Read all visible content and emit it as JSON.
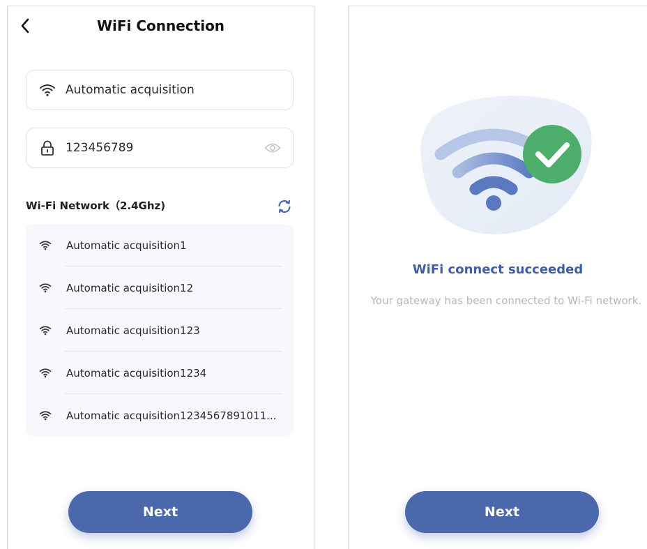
{
  "left_screen": {
    "header": {
      "title": "WiFi Connection",
      "back_icon": "chevron-left-icon"
    },
    "ssid_field": {
      "value": "Automatic acquisition",
      "icon": "wifi-icon"
    },
    "password_field": {
      "value": "123456789",
      "icon": "lock-icon",
      "toggle_icon": "eye-icon"
    },
    "network_section": {
      "title": "Wi-Fi Network（2.4Ghz)",
      "refresh_icon": "refresh-icon"
    },
    "networks": [
      {
        "name": "Automatic acquisition1"
      },
      {
        "name": "Automatic acquisition12"
      },
      {
        "name": "Automatic acquisition123"
      },
      {
        "name": "Automatic acquisition1234"
      },
      {
        "name": "Automatic acquisition1234567891011..."
      }
    ],
    "next_button": {
      "label": "Next"
    }
  },
  "right_screen": {
    "illustration_icon": "wifi-success-icon",
    "title": "WiFi connect succeeded",
    "description": "Your gateway has been connected to Wi-Fi network.",
    "next_button": {
      "label": "Next"
    }
  },
  "colors": {
    "primary": "#4b68ad",
    "success": "#4cae6a",
    "list_background": "#f6f8fb",
    "muted_text": "#b7b7b7"
  }
}
